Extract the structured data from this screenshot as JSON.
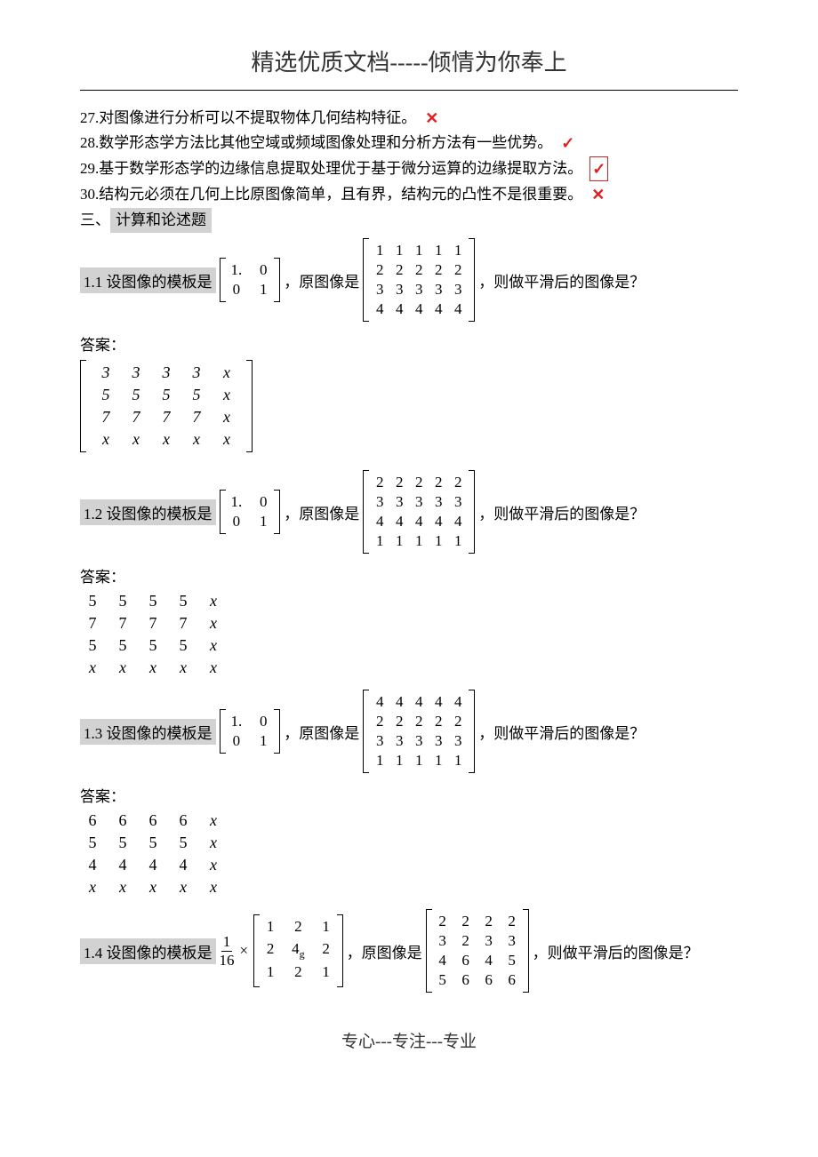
{
  "header": {
    "title": "精选优质文档-----倾情为你奉上"
  },
  "statements": [
    {
      "num": "27.",
      "text": "对图像进行分析可以不提取物体几何结构特征。",
      "mark": "cross"
    },
    {
      "num": "28.",
      "text": "数学形态学方法比其他空域或频域图像处理和分析方法有一些优势。",
      "mark": "check"
    },
    {
      "num": "29.",
      "text": "基于数学形态学的边缘信息提取处理优于基于微分运算的边缘提取方法。",
      "mark": "check_boxed"
    },
    {
      "num": "30.",
      "text": "结构元必须在几何上比原图像简单，且有界，结构元的凸性不是很重要。",
      "mark": "cross"
    }
  ],
  "section3": {
    "prefix": "三、",
    "title": "计算和论述题"
  },
  "problems": {
    "p11": {
      "label": "1.1 设图像的模板是",
      "template": [
        [
          "1.",
          "0"
        ],
        [
          "0",
          "1"
        ]
      ],
      "mid": "，原图像是",
      "image": [
        [
          "1",
          "1",
          "1",
          "1",
          "1"
        ],
        [
          "2",
          "2",
          "2",
          "2",
          "2"
        ],
        [
          "3",
          "3",
          "3",
          "3",
          "3"
        ],
        [
          "4",
          "4",
          "4",
          "4",
          "4"
        ]
      ],
      "tail": "，则做平滑后的图像是？",
      "answer_label": "答案：",
      "answer": [
        [
          "3",
          "3",
          "3",
          "3",
          "x"
        ],
        [
          "5",
          "5",
          "5",
          "5",
          "x"
        ],
        [
          "7",
          "7",
          "7",
          "7",
          "x"
        ],
        [
          "x",
          "x",
          "x",
          "x",
          "x"
        ]
      ],
      "answer_bracketed": true
    },
    "p12": {
      "label": "1.2 设图像的模板是",
      "template": [
        [
          "1.",
          "0"
        ],
        [
          "0",
          "1"
        ]
      ],
      "mid": "，原图像是",
      "image": [
        [
          "2",
          "2",
          "2",
          "2",
          "2"
        ],
        [
          "3",
          "3",
          "3",
          "3",
          "3"
        ],
        [
          "4",
          "4",
          "4",
          "4",
          "4"
        ],
        [
          "1",
          "1",
          "1",
          "1",
          "1"
        ]
      ],
      "tail": "，则做平滑后的图像是？",
      "answer_label": "答案：",
      "answer": [
        [
          "5",
          "5",
          "5",
          "5",
          "x"
        ],
        [
          "7",
          "7",
          "7",
          "7",
          "x"
        ],
        [
          "5",
          "5",
          "5",
          "5",
          "x"
        ],
        [
          "x",
          "x",
          "x",
          "x",
          "x"
        ]
      ],
      "answer_bracketed": false
    },
    "p13": {
      "label": "1.3 设图像的模板是",
      "template": [
        [
          "1.",
          "0"
        ],
        [
          "0",
          "1"
        ]
      ],
      "mid": "，原图像是",
      "image": [
        [
          "4",
          "4",
          "4",
          "4",
          "4"
        ],
        [
          "2",
          "2",
          "2",
          "2",
          "2"
        ],
        [
          "3",
          "3",
          "3",
          "3",
          "3"
        ],
        [
          "1",
          "1",
          "1",
          "1",
          "1"
        ]
      ],
      "tail": "，则做平滑后的图像是？",
      "answer_label": "答案：",
      "answer": [
        [
          "6",
          "6",
          "6",
          "6",
          "x"
        ],
        [
          "5",
          "5",
          "5",
          "5",
          "x"
        ],
        [
          "4",
          "4",
          "4",
          "4",
          "x"
        ],
        [
          "x",
          "x",
          "x",
          "x",
          "x"
        ]
      ],
      "answer_bracketed": false
    },
    "p14": {
      "label": "1.4 设图像的模板是",
      "frac": {
        "num": "1",
        "den": "16"
      },
      "times": "×",
      "template3": [
        [
          "1",
          "2",
          "1"
        ],
        [
          "2",
          "4g",
          "2"
        ],
        [
          "1",
          "2",
          "1"
        ]
      ],
      "mid": "，原图像是",
      "image4": [
        [
          "2",
          "2",
          "2",
          "2"
        ],
        [
          "3",
          "2",
          "3",
          "3"
        ],
        [
          "4",
          "6",
          "4",
          "5"
        ],
        [
          "5",
          "6",
          "6",
          "6"
        ]
      ],
      "tail": "，则做平滑后的图像是？"
    }
  },
  "footer": {
    "text": "专心---专注---专业"
  },
  "glyphs": {
    "cross": "✕",
    "check": "✓"
  }
}
